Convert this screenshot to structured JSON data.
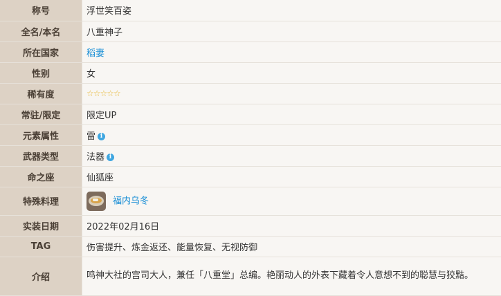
{
  "rows": [
    {
      "label": "称号",
      "value": "浮世笑百姿"
    },
    {
      "label": "全名/本名",
      "value": "八重神子"
    },
    {
      "label": "所在国家",
      "value": "稻妻"
    },
    {
      "label": "性别",
      "value": "女"
    },
    {
      "label": "稀有度",
      "value": "☆☆☆☆☆",
      "rating": 5
    },
    {
      "label": "常驻/限定",
      "value": "限定UP"
    },
    {
      "label": "元素属性",
      "value": "雷",
      "icon": "info-icon"
    },
    {
      "label": "武器类型",
      "value": "法器",
      "icon": "info-icon"
    },
    {
      "label": "命之座",
      "value": "仙狐座"
    },
    {
      "label": "特殊料理",
      "value": "福内乌冬",
      "icon": "food-dish-icon"
    },
    {
      "label": "实装日期",
      "value": "2022年02月16日"
    },
    {
      "label": "TAG",
      "value": "伤害提升、炼金返还、能量恢复、无视防御"
    },
    {
      "label": "介绍",
      "value": "鸣神大社的宫司大人，兼任「八重堂」总编。艳丽动人的外表下藏着令人意想不到的聪慧与狡黠。"
    }
  ],
  "colors": {
    "header_bg": "#ddd2c5",
    "value_bg": "#f8f6f3",
    "link": "#1a8fd6",
    "star": "#e6b52d",
    "info": "#3fa6e0"
  }
}
